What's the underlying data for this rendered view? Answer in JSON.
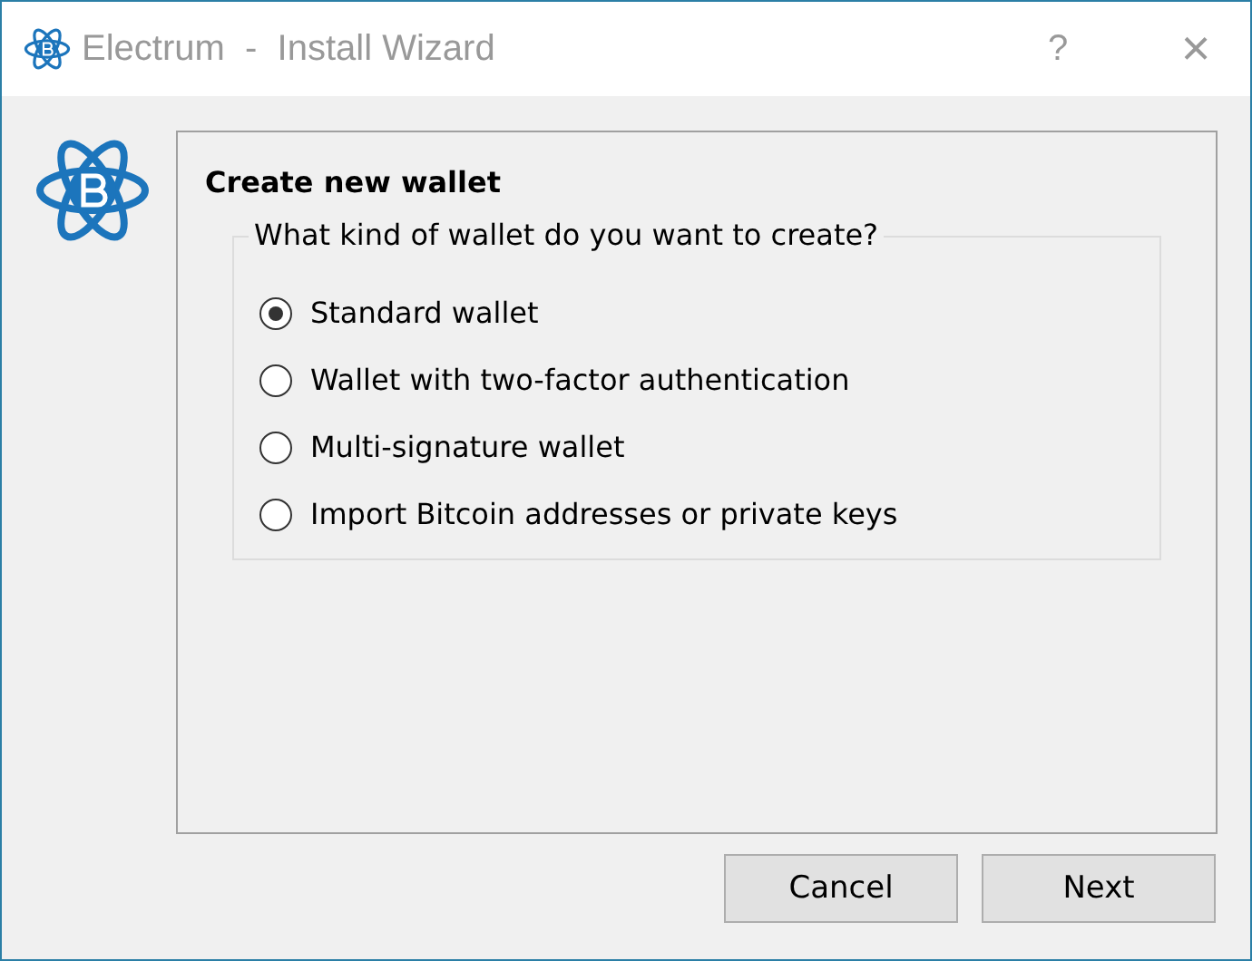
{
  "window": {
    "title": "Electrum  -  Install Wizard",
    "help": "?",
    "close": "×"
  },
  "page": {
    "heading": "Create new wallet",
    "group_title": "What kind of wallet do you want to create?",
    "options": [
      {
        "label": "Standard wallet",
        "selected": true
      },
      {
        "label": "Wallet with two-factor authentication",
        "selected": false
      },
      {
        "label": "Multi-signature wallet",
        "selected": false
      },
      {
        "label": "Import Bitcoin addresses or private keys",
        "selected": false
      }
    ]
  },
  "buttons": [
    {
      "label": "Cancel"
    },
    {
      "label": "Next"
    }
  ]
}
